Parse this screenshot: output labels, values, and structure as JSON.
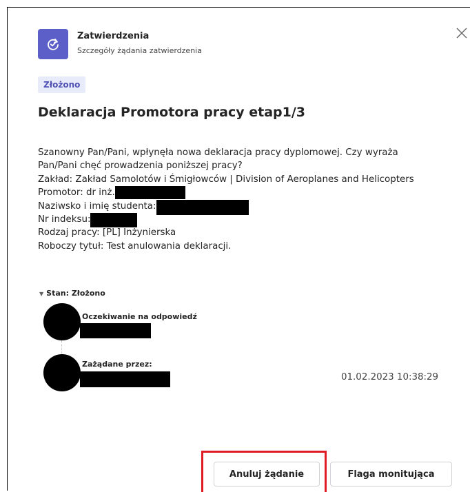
{
  "header": {
    "app_title": "Zatwierdzenia",
    "app_subtitle": "Szczegóły żądania zatwierdzenia",
    "icon": "approvals-icon",
    "close_icon": "close-icon"
  },
  "status_badge": "Złożono",
  "title": "Deklaracja Promotora pracy etap1/3",
  "body": {
    "line1": "Szanowny Pan/Pani, wpłynęła nowa deklaracja pracy dyplomowej. Czy wyraża",
    "line2": "Pan/Pani chęć prowadzenia poniższej pracy?",
    "line3": "Zakład: Zakład Samolotów i Śmigłowców | Division of Aeroplanes and Helicopters",
    "promotor_label": "Promotor: dr inż.",
    "student_label": "Naziwsko i imię studenta:",
    "index_label": "Nr indeksu:",
    "work_type": "Rodzaj pracy: [PL] Inżynierska",
    "working_title": "Roboczy tytuł:  Test anulowania deklaracji."
  },
  "status": {
    "header": "Stan: Złożono",
    "steps": [
      {
        "label": "Oczekiwanie na odpowiedź"
      },
      {
        "label": "Zażądane przez:",
        "timestamp": "01.02.2023 10:38:29"
      }
    ]
  },
  "actions": {
    "cancel_label": "Anuluj żądanie",
    "flag_label": "Flaga monitująca"
  },
  "colors": {
    "accent": "#5b5fc7",
    "badge_bg": "#e8ebfa",
    "badge_text": "#4f52b2",
    "highlight": "#e01b24"
  }
}
